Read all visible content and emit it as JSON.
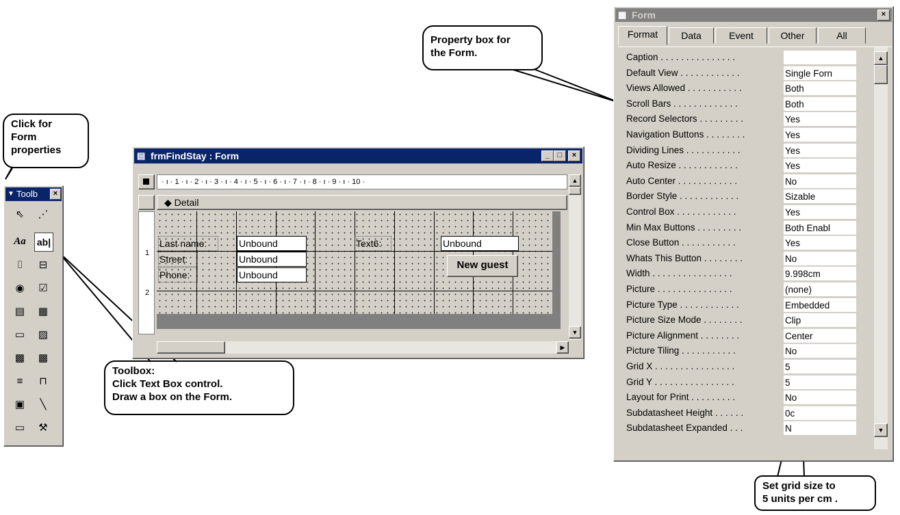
{
  "callouts": {
    "form_props": "Click for\nForm\nproperties",
    "property_box": "Property box for\nthe Form.",
    "toolbox": "Toolbox:\nClick Text Box control.\nDraw  a box on the Form.",
    "grid_size": "Set grid size to\n5 units per cm ."
  },
  "toolbox": {
    "title": "Toolb",
    "close": "×",
    "tools": [
      {
        "name": "select-objects-icon",
        "glyph": "⇖"
      },
      {
        "name": "control-wizards-icon",
        "glyph": "⋰"
      },
      {
        "name": "label-tool-icon",
        "glyph": "Aa"
      },
      {
        "name": "text-box-tool-icon",
        "glyph": "ab|"
      },
      {
        "name": "option-group-icon",
        "glyph": "⌷"
      },
      {
        "name": "toggle-button-icon",
        "glyph": "⊟"
      },
      {
        "name": "option-button-icon",
        "glyph": "◉"
      },
      {
        "name": "check-box-icon",
        "glyph": "☑"
      },
      {
        "name": "combo-box-icon",
        "glyph": "▤"
      },
      {
        "name": "list-box-icon",
        "glyph": "▦"
      },
      {
        "name": "command-button-icon",
        "glyph": "▭"
      },
      {
        "name": "image-tool-icon",
        "glyph": "▨"
      },
      {
        "name": "unbound-object-frame-icon",
        "glyph": "▩"
      },
      {
        "name": "bound-object-frame-icon",
        "glyph": "▩"
      },
      {
        "name": "page-break-icon",
        "glyph": "≡"
      },
      {
        "name": "tab-control-icon",
        "glyph": "⊓"
      },
      {
        "name": "subform-icon",
        "glyph": "▣"
      },
      {
        "name": "line-tool-icon",
        "glyph": "╲"
      },
      {
        "name": "rectangle-tool-icon",
        "glyph": "▭"
      },
      {
        "name": "more-controls-icon",
        "glyph": "⚒"
      }
    ]
  },
  "form_window": {
    "title": "frmFindStay : Form",
    "ruler": "· ı · 1 · ı · 2 · ı · 3 · ı · 4 · ı · 5 · ı · 6 · ı · 7 · ı · 8 · ı · 9 · ı · 10 ·",
    "section": "Detail",
    "vruler_1": "1",
    "vruler_2": "2",
    "controls": {
      "lastname_label": "Last name:",
      "lastname_box": "Unbound",
      "street_label": "Street:",
      "street_box": "Unbound",
      "phone_label": "Phone:",
      "phone_box": "Unbound",
      "text6_label": "Text6:",
      "text6_box": "Unbound",
      "new_guest_button": "New guest"
    }
  },
  "property_window": {
    "title": "Form",
    "tabs": [
      "Format",
      "Data",
      "Event",
      "Other",
      "All"
    ],
    "rows": [
      {
        "name": "Caption . . . . . . . . . . . . . . .",
        "value": ""
      },
      {
        "name": "Default View . . . . . . . . . . . .",
        "value": "Single Forn"
      },
      {
        "name": "Views Allowed . . . . . . . . . . .",
        "value": "Both"
      },
      {
        "name": "Scroll Bars . . . . . . . . . . . . .",
        "value": "Both"
      },
      {
        "name": "Record Selectors . . . . . . . . .",
        "value": "Yes"
      },
      {
        "name": "Navigation Buttons . . . . . . . .",
        "value": "Yes"
      },
      {
        "name": "Dividing Lines . . . . . . . . . . .",
        "value": "Yes"
      },
      {
        "name": "Auto Resize . . . . . . . . . . . .",
        "value": "Yes"
      },
      {
        "name": "Auto Center . . . . . . . . . . . .",
        "value": "No"
      },
      {
        "name": "Border Style . . . . . . . . . . . .",
        "value": "Sizable"
      },
      {
        "name": "Control Box . . . . . . . . . . . .",
        "value": "Yes"
      },
      {
        "name": "Min Max Buttons . . . . . . . . .",
        "value": "Both Enabl"
      },
      {
        "name": "Close Button . . . . . . . . . . .",
        "value": "Yes"
      },
      {
        "name": "Whats This Button . . . . . . . .",
        "value": "No"
      },
      {
        "name": "Width . . . . . . . . . . . . . . . .",
        "value": "9.998cm"
      },
      {
        "name": "Picture . . . . . . . . . . . . . . .",
        "value": "(none)"
      },
      {
        "name": "Picture Type . . . . . . . . . . . .",
        "value": "Embedded"
      },
      {
        "name": "Picture Size Mode . . . . . . . .",
        "value": "Clip"
      },
      {
        "name": "Picture Alignment . . . . . . . .",
        "value": "Center"
      },
      {
        "name": "Picture Tiling . . . . . . . . . . .",
        "value": "No"
      },
      {
        "name": "Grid X . . . . . . . . . . . . . . . .",
        "value": "5"
      },
      {
        "name": "Grid Y . . . . . . . . . . . . . . . .",
        "value": "5"
      },
      {
        "name": "Layout for Print . . . . . . . . .",
        "value": "No"
      },
      {
        "name": "Subdatasheet Height . . . . . .",
        "value": "0c"
      },
      {
        "name": "Subdatasheet Expanded . . .",
        "value": "N"
      }
    ]
  }
}
